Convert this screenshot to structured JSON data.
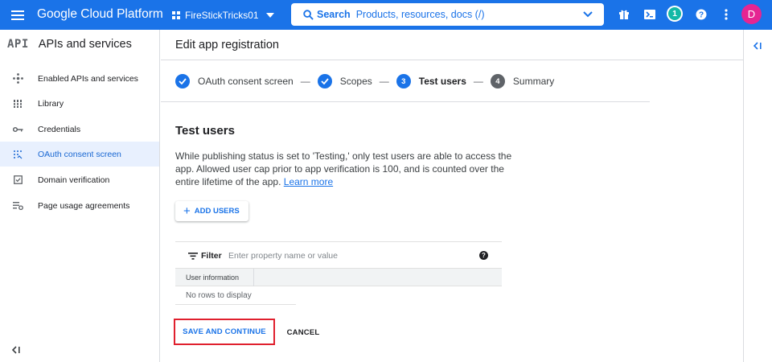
{
  "topbar": {
    "brand": "Google Cloud Platform",
    "project": "FireStickTricks01",
    "search_label": "Search",
    "search_placeholder": "Products, resources, docs (/)",
    "notifications_count": "1",
    "avatar_initial": "D",
    "color": "#1a73e8"
  },
  "sidebar": {
    "logo": "API",
    "title": "APIs and services",
    "items": [
      {
        "label": "Enabled APIs and services",
        "icon": "hub-icon"
      },
      {
        "label": "Library",
        "icon": "library-icon"
      },
      {
        "label": "Credentials",
        "icon": "key-icon"
      },
      {
        "label": "OAuth consent screen",
        "icon": "consent-icon",
        "active": true
      },
      {
        "label": "Domain verification",
        "icon": "checkbox-icon"
      },
      {
        "label": "Page usage agreements",
        "icon": "settings-list-icon"
      }
    ]
  },
  "main": {
    "page_title": "Edit app registration",
    "steps": [
      {
        "label": "OAuth consent screen",
        "state": "done"
      },
      {
        "label": "Scopes",
        "state": "done"
      },
      {
        "number": "3",
        "label": "Test users",
        "state": "current"
      },
      {
        "number": "4",
        "label": "Summary",
        "state": "todo"
      }
    ],
    "step_separator": "—",
    "section_title": "Test users",
    "description": "While publishing status is set to 'Testing,' only test users are able to access the app. Allowed user cap prior to app verification is 100, and is counted over the entire lifetime of the app.",
    "learn_more": "Learn more",
    "add_users": "ADD USERS",
    "table": {
      "filter_label": "Filter",
      "filter_placeholder": "Enter property name or value",
      "columns": [
        "User information"
      ],
      "empty_text": "No rows to display"
    },
    "save_button": "SAVE AND CONTINUE",
    "cancel_button": "CANCEL"
  }
}
